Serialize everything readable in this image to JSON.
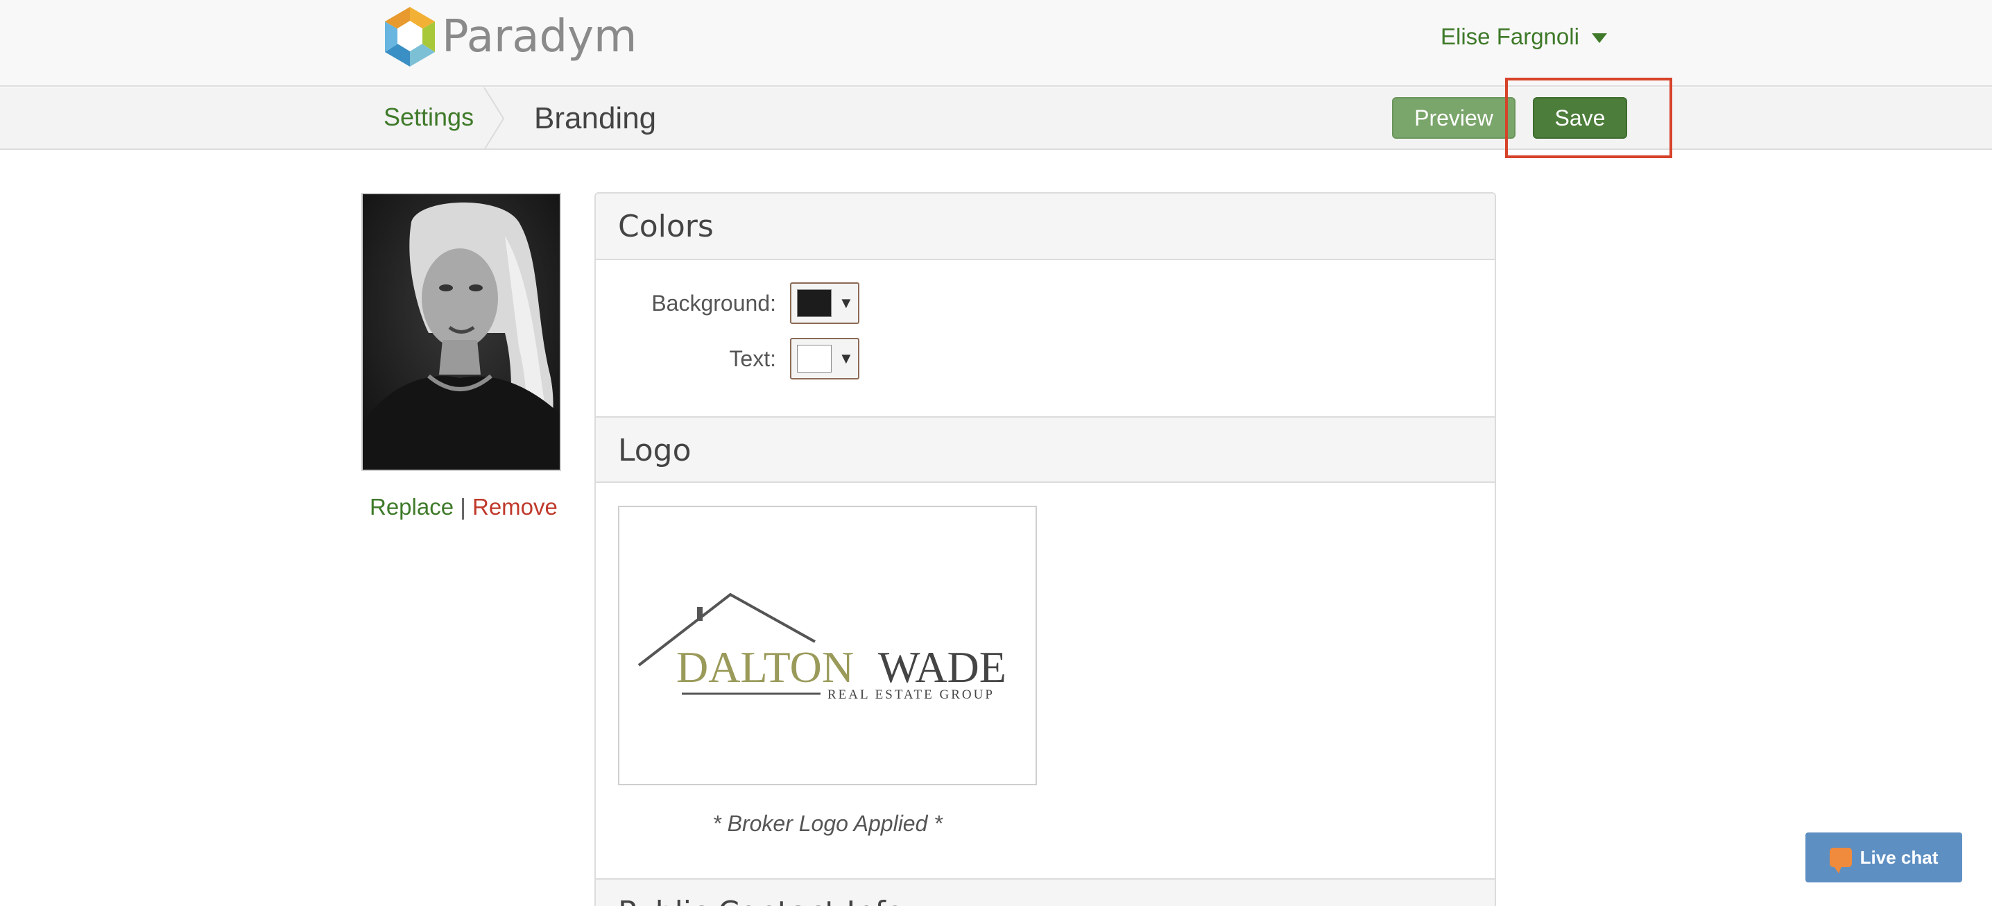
{
  "app": {
    "brand_name": "Paradym"
  },
  "header": {
    "user_name": "Elise Fargnoli"
  },
  "subheader": {
    "breadcrumb_parent": "Settings",
    "page_title": "Branding",
    "preview_label": "Preview",
    "save_label": "Save"
  },
  "profile_photo": {
    "replace_label": "Replace",
    "separator": "|",
    "remove_label": "Remove"
  },
  "colors_section": {
    "title": "Colors",
    "background_label": "Background:",
    "background_color": "#1c1c1c",
    "text_label": "Text:",
    "text_color": "#ffffff"
  },
  "logo_section": {
    "title": "Logo",
    "logo_word_1": "DALTON",
    "logo_word_2": "WADE",
    "logo_tagline": "REAL ESTATE GROUP",
    "caption": "* Broker Logo Applied *"
  },
  "public_section": {
    "title": "Public Contact Info"
  },
  "livechat": {
    "label": "Live chat"
  },
  "theme": {
    "accent_green": "#3f7a2a",
    "save_green": "#4c7d3a",
    "preview_green": "#7aa56b",
    "remove_red": "#c0392b",
    "highlight_red": "#d6432a",
    "livechat_blue": "#5e8fc2"
  }
}
